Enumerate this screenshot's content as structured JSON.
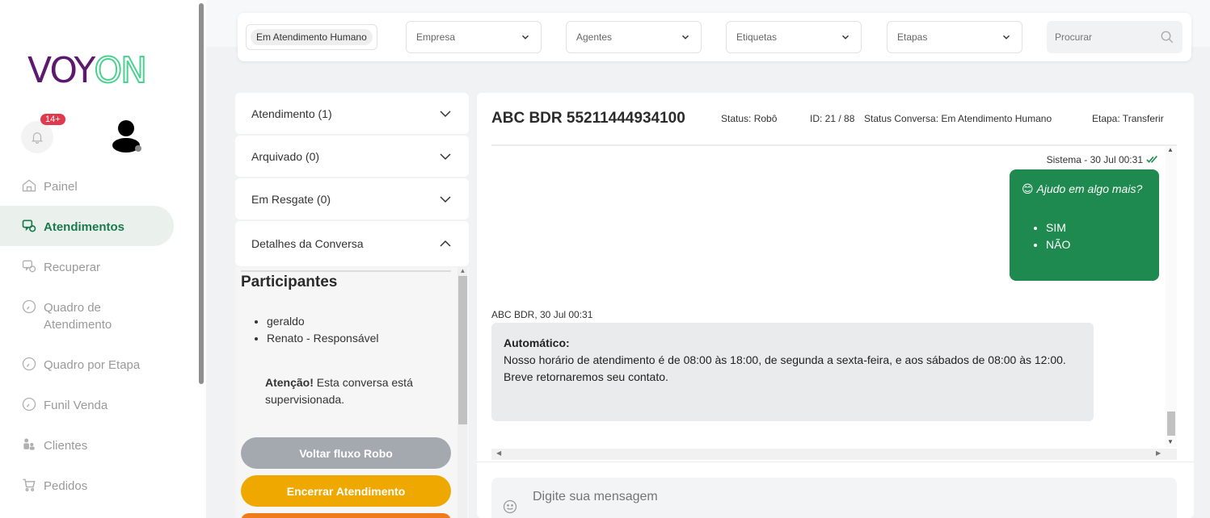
{
  "brand": {
    "logo_part1": "VOY",
    "logo_part2": "ON"
  },
  "notifications": {
    "badge": "14+"
  },
  "sidebar": {
    "items": [
      {
        "label": "Painel",
        "icon": "home-icon"
      },
      {
        "label": "Atendimentos",
        "icon": "chat-icon",
        "active": true
      },
      {
        "label": "Recuperar",
        "icon": "chat-recover-icon"
      },
      {
        "label": "Quadro de Atendimento",
        "icon": "gauge-icon"
      },
      {
        "label": "Quadro por Etapa",
        "icon": "gauge-icon"
      },
      {
        "label": "Funil Venda",
        "icon": "gauge-icon"
      },
      {
        "label": "Clientes",
        "icon": "users-icon"
      },
      {
        "label": "Pedidos",
        "icon": "cart-icon"
      }
    ]
  },
  "filters": {
    "chip": "Em Atendimento Humano",
    "empresa": "Empresa",
    "agentes": "Agentes",
    "etiquetas": "Etiquetas",
    "etapas": "Etapas",
    "search_placeholder": "Procurar"
  },
  "accordion": {
    "items": [
      {
        "label": "Atendimento (1)",
        "expanded": false
      },
      {
        "label": "Arquivado (0)",
        "expanded": false
      },
      {
        "label": "Em Resgate (0)",
        "expanded": false
      },
      {
        "label": "Detalhes da Conversa",
        "expanded": true
      }
    ],
    "details": {
      "participants_title": "Participantes",
      "participants": [
        "geraldo",
        "Renato - Responsável"
      ],
      "warning_bold": "Atenção!",
      "warning_text": " Esta conversa está supervisionada.",
      "btn_back_robot": "Voltar fluxo Robo",
      "btn_end": "Encerrar Atendimento"
    }
  },
  "chat": {
    "title": "ABC BDR 55211444934100",
    "status": "Status: Robô",
    "id": "ID: 21 / 88",
    "status_conversa": "Status Conversa: Em Atendimento Humano",
    "etapa": "Etapa: Transferir",
    "messages": {
      "system_meta": "Sistema - 30 Jul 00:31",
      "system_emoji": "😊",
      "system_question": "Ajudo em algo mais?",
      "system_options": [
        "SIM",
        "NÃO"
      ],
      "contact_meta": "ABC BDR, 30 Jul 00:31",
      "contact_title": "Automático:",
      "contact_line1": "Nosso horário de atendimento é de 08:00 às 18:00, de segunda a sexta-feira, e aos sábados de 08:00 às 12:00.",
      "contact_line2": "Breve retornaremos seu contato."
    },
    "composer_placeholder": "Digite sua mensagem"
  },
  "colors": {
    "brand_purple": "#5b1a6e",
    "brand_green": "#4bd18f",
    "active_green": "#1a7a4c",
    "bubble_green": "#1e8a4f",
    "btn_yellow": "#eea800",
    "btn_gray": "#a4a9af",
    "badge_red": "#e03a4e"
  }
}
